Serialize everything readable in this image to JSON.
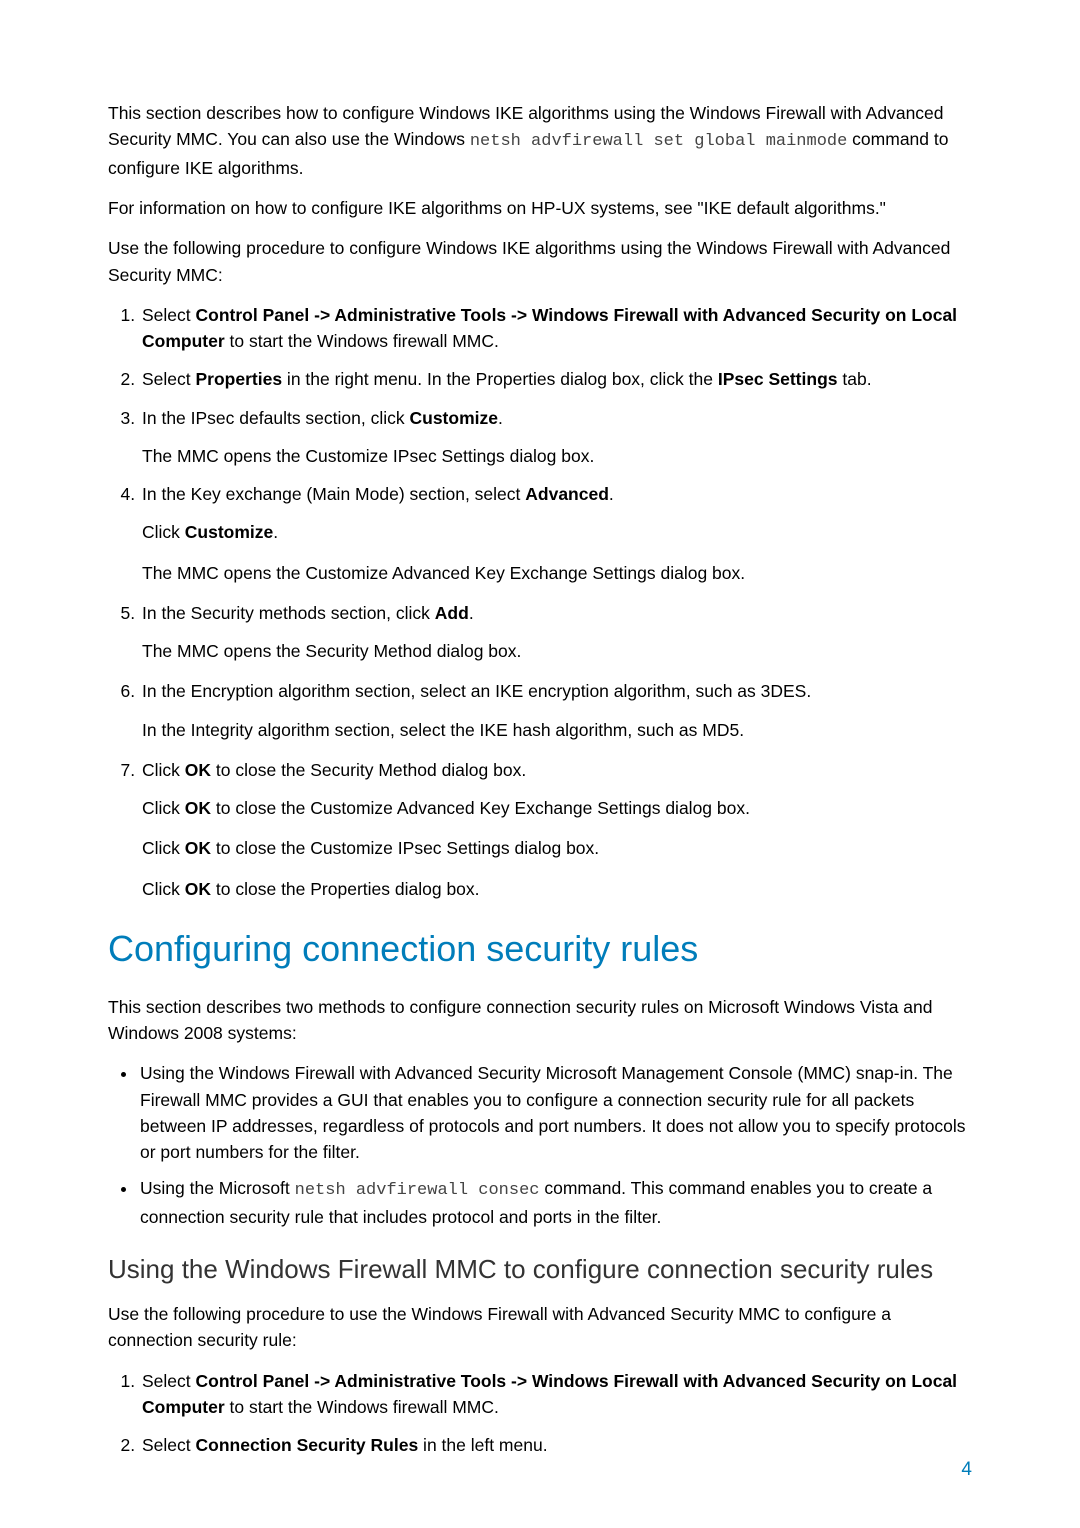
{
  "intro1_a": "This section describes how to configure Windows IKE algorithms using the Windows Firewall with Advanced Security MMC. You can also use the Windows ",
  "intro1_code": "netsh advfirewall set global mainmode",
  "intro1_b": " command to configure IKE algorithms.",
  "intro2": "For information on how to configure IKE algorithms on HP-UX systems, see \"IKE default algorithms.\"",
  "intro3": "Use the following procedure to configure Windows IKE algorithms using the Windows Firewall with Advanced Security MMC:",
  "step1_a": "Select ",
  "step1_b": "Control Panel -> Administrative Tools -> Windows Firewall with Advanced Security on Local Computer",
  "step1_c": " to start the Windows firewall MMC.",
  "step2_a": "Select ",
  "step2_b": "Properties",
  "step2_c": " in the right menu. In the Properties dialog box, click the ",
  "step2_d": "IPsec Settings",
  "step2_e": " tab.",
  "step3_a": "In the IPsec defaults section, click ",
  "step3_b": "Customize",
  "step3_c": ".",
  "step3_sub": "The MMC opens the Customize IPsec Settings dialog box.",
  "step4_a": "In the Key exchange (Main Mode) section, select ",
  "step4_b": "Advanced",
  "step4_c": ".",
  "step4_sub1_a": "Click ",
  "step4_sub1_b": "Customize",
  "step4_sub1_c": ".",
  "step4_sub2": "The MMC opens the Customize Advanced Key Exchange Settings dialog box.",
  "step5_a": "In the Security methods section, click ",
  "step5_b": "Add",
  "step5_c": ".",
  "step5_sub": "The MMC opens the Security Method dialog box.",
  "step6": "In the Encryption algorithm section, select an IKE encryption algorithm, such as 3DES.",
  "step6_sub": "In the Integrity algorithm section, select the IKE hash algorithm, such as MD5.",
  "step7_a": "Click ",
  "step7_b": "OK",
  "step7_c": " to close the Security Method dialog box.",
  "step7_sub1_a": "Click ",
  "step7_sub1_b": "OK",
  "step7_sub1_c": " to close the Customize Advanced Key Exchange Settings dialog box.",
  "step7_sub2_a": "Click ",
  "step7_sub2_b": "OK",
  "step7_sub2_c": " to close the Customize IPsec Settings dialog box.",
  "step7_sub3_a": "Click ",
  "step7_sub3_b": "OK",
  "step7_sub3_c": " to close the Properties dialog box.",
  "h1": "Configuring connection security rules",
  "p_after_h1": "This section describes two methods to configure connection security rules on Microsoft Windows Vista and Windows 2008 systems:",
  "bullet1": "Using the Windows Firewall with Advanced Security Microsoft Management Console (MMC) snap-in. The Firewall MMC provides a GUI that enables you to configure a connection security rule for all packets between IP addresses, regardless of protocols and port numbers. It does not allow you to specify protocols or port numbers for the filter.",
  "bullet2_a": "Using the Microsoft ",
  "bullet2_code": "netsh advfirewall consec",
  "bullet2_b": " command. This command enables you to create a connection security rule that includes protocol and ports in the filter.",
  "h2": "Using the Windows Firewall MMC to configure connection security rules",
  "p_after_h2": "Use the following procedure to use the Windows Firewall with Advanced Security MMC to configure a connection security rule:",
  "ol2_step1_a": "Select ",
  "ol2_step1_b": "Control Panel -> Administrative Tools -> Windows Firewall with Advanced Security on Local Computer",
  "ol2_step1_c": " to start the Windows firewall MMC.",
  "ol2_step2_a": "Select ",
  "ol2_step2_b": "Connection Security Rules",
  "ol2_step2_c": " in the left menu.",
  "page_num": "4"
}
